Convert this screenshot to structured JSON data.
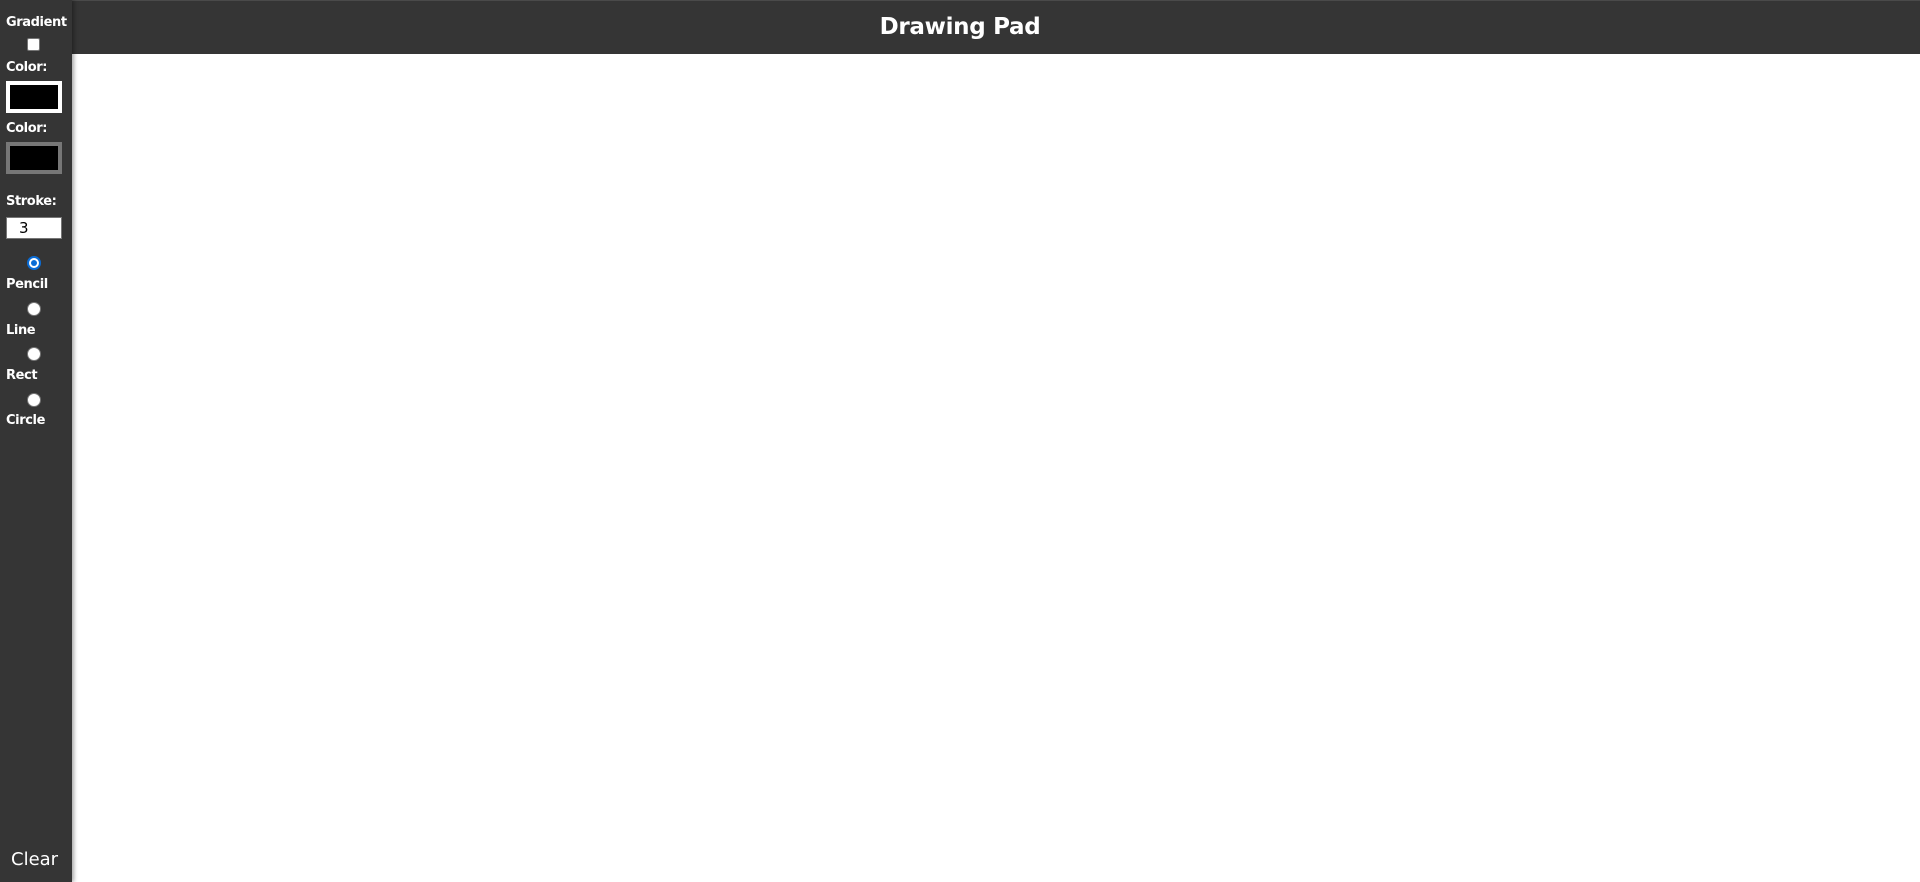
{
  "header": {
    "title": "Drawing Pad"
  },
  "toolbar": {
    "gradient_label": "Gradient",
    "gradient_checked": false,
    "color1_label": "Color:",
    "color1_value": "#000000",
    "color2_label": "Color:",
    "color2_value": "#000000",
    "stroke_label": "Stroke:",
    "stroke_value": "3",
    "tools": [
      {
        "label": "Pencil",
        "selected": true
      },
      {
        "label": "Line",
        "selected": false
      },
      {
        "label": "Rect",
        "selected": false
      },
      {
        "label": "Circle",
        "selected": false
      }
    ],
    "clear_label": "Clear"
  },
  "colors": {
    "panel": "#353535",
    "canvas": "#ffffff",
    "accent": "#0a6cd6"
  }
}
